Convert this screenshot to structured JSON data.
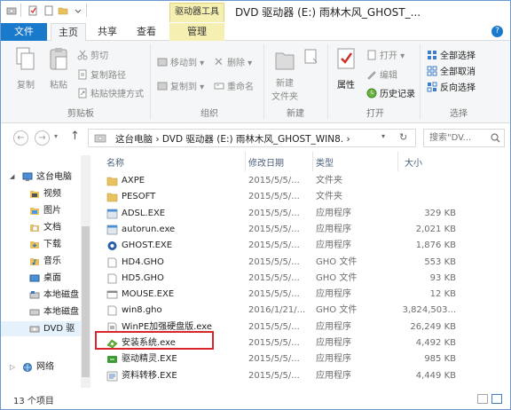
{
  "title_bar": {
    "context_tab": "驱动器工具",
    "title": "DVD 驱动器 (E:) 雨林木风_GHOST_..."
  },
  "ribbon_tabs": {
    "file": "文件",
    "home": "主页",
    "share": "共享",
    "view": "查看",
    "manage": "管理"
  },
  "ribbon": {
    "copy": "复制",
    "paste": "粘贴",
    "cut": "剪切",
    "copy_path": "复制路径",
    "paste_shortcut": "粘贴快捷方式",
    "clipboard_group": "剪贴板",
    "move_to": "移动到",
    "copy_to": "复制到",
    "delete": "删除",
    "rename": "重命名",
    "organize_group": "组织",
    "new_folder_l1": "新建",
    "new_folder_l2": "文件夹",
    "new_group": "新建",
    "properties": "属性",
    "open": "打开",
    "edit": "编辑",
    "history": "历史记录",
    "open_group": "打开",
    "select_all": "全部选择",
    "select_none": "全部取消",
    "invert": "反向选择",
    "select_group": "选择"
  },
  "address": {
    "path": "这台电脑  ›  DVD 驱动器 (E:) 雨林木风_GHOST_WIN8.  ›",
    "search_placeholder": "搜索\"DV..."
  },
  "nav_pane": {
    "items": [
      {
        "label": "这台电脑",
        "icon": "computer-icon"
      },
      {
        "label": "视频",
        "icon": "video-folder-icon"
      },
      {
        "label": "图片",
        "icon": "pictures-folder-icon"
      },
      {
        "label": "文档",
        "icon": "documents-folder-icon"
      },
      {
        "label": "下载",
        "icon": "downloads-folder-icon"
      },
      {
        "label": "音乐",
        "icon": "music-folder-icon"
      },
      {
        "label": "桌面",
        "icon": "desktop-folder-icon"
      },
      {
        "label": "本地磁盘",
        "icon": "drive-icon"
      },
      {
        "label": "本地磁盘",
        "icon": "drive-icon"
      },
      {
        "label": "DVD 驱",
        "icon": "dvd-drive-icon"
      },
      {
        "label": "网络",
        "icon": "network-icon"
      }
    ]
  },
  "columns": {
    "name": "名称",
    "date": "修改日期",
    "type": "类型",
    "size": "大小"
  },
  "files": [
    {
      "name": "AXPE",
      "date": "2015/5/5/...",
      "type": "文件夹",
      "size": "",
      "icon": "folder-icon"
    },
    {
      "name": "PESOFT",
      "date": "2015/5/5/...",
      "type": "文件夹",
      "size": "",
      "icon": "folder-icon"
    },
    {
      "name": "ADSL.EXE",
      "date": "2015/5/5/...",
      "type": "应用程序",
      "size": "329 KB",
      "icon": "app-icon"
    },
    {
      "name": "autorun.exe",
      "date": "2015/5/5/...",
      "type": "应用程序",
      "size": "2,021 KB",
      "icon": "app-icon"
    },
    {
      "name": "GHOST.EXE",
      "date": "2015/5/5/...",
      "type": "应用程序",
      "size": "1,876 KB",
      "icon": "ghost-app-icon"
    },
    {
      "name": "HD4.GHO",
      "date": "2015/5/5/...",
      "type": "GHO 文件",
      "size": "553 KB",
      "icon": "file-icon"
    },
    {
      "name": "HD5.GHO",
      "date": "2015/5/5/...",
      "type": "GHO 文件",
      "size": "93 KB",
      "icon": "file-icon"
    },
    {
      "name": "MOUSE.EXE",
      "date": "2015/5/5/...",
      "type": "应用程序",
      "size": "12 KB",
      "icon": "exe-icon"
    },
    {
      "name": "win8.gho",
      "date": "2016/1/21/...",
      "type": "GHO 文件",
      "size": "3,824,503...",
      "icon": "file-icon"
    },
    {
      "name": "WinPE加强硬盘版.exe",
      "date": "2015/5/5/...",
      "type": "应用程序",
      "size": "26,249 KB",
      "icon": "winpe-app-icon"
    },
    {
      "name": "安装系统.exe",
      "date": "2015/5/5/...",
      "type": "应用程序",
      "size": "4,492 KB",
      "icon": "install-app-icon"
    },
    {
      "name": "驱动精灵.EXE",
      "date": "2015/5/5/...",
      "type": "应用程序",
      "size": "985 KB",
      "icon": "driver-app-icon"
    },
    {
      "name": "资料转移.EXE",
      "date": "2015/5/5/...",
      "type": "应用程序",
      "size": "4,449 KB",
      "icon": "transfer-app-icon"
    }
  ],
  "status": {
    "item_count": "13 个项目"
  },
  "colors": {
    "file_tab": "#1979ca",
    "manage_tab": "#f6efb2",
    "highlight_border": "#d9262d",
    "folder": "#e8c160"
  }
}
